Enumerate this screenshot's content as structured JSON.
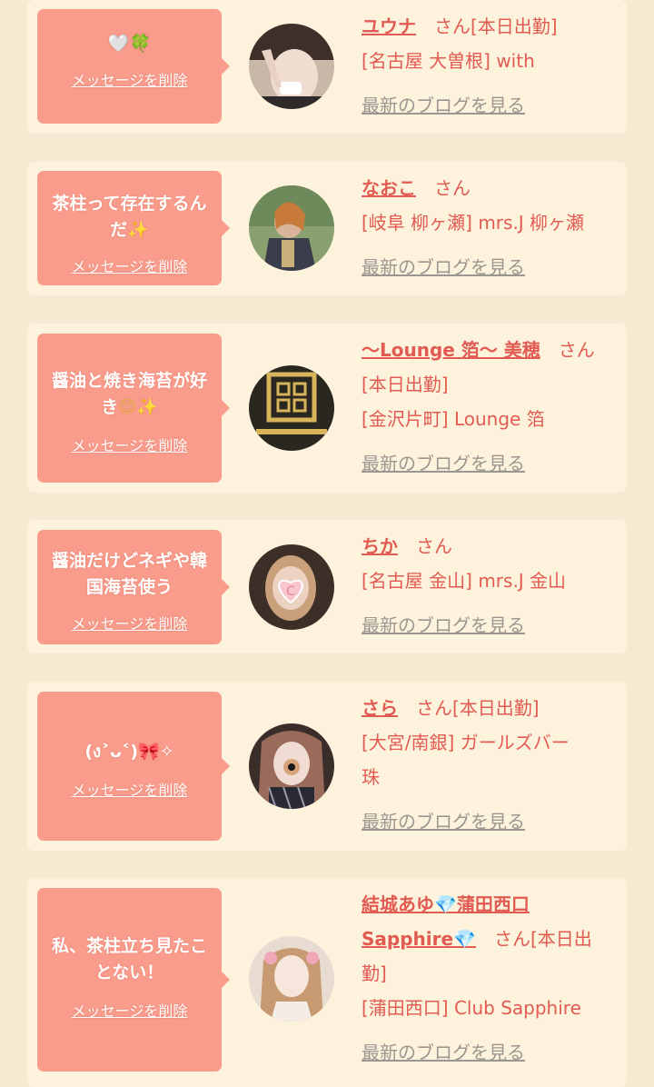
{
  "delete_label": "メッセージを削除",
  "blog_label": "最新のブログを見る",
  "cards": [
    {
      "message": "",
      "message_emoji": "🤍🍀",
      "name": "ユウナ",
      "suffix": "　さん[本日出勤]",
      "lines": [
        "[名古屋 大曽根] with"
      ]
    },
    {
      "message": "茶柱って存在するんだ",
      "message_emoji": "✨",
      "name": "なおこ",
      "suffix": "　さん",
      "lines": [
        "[岐阜 柳ヶ瀬] mrs.J 柳ヶ瀬"
      ]
    },
    {
      "message": "醤油と焼き海苔が好き",
      "message_emoji": "😊✨",
      "name": "〜Lounge 箔〜 美穂",
      "suffix": "　さん",
      "lines": [
        "[本日出勤]",
        "[金沢片町] Lounge 箔"
      ]
    },
    {
      "message": "醤油だけどネギや韓国海苔使う",
      "message_emoji": "",
      "name": "ちか",
      "suffix": "　さん",
      "lines": [
        "[名古屋 金山] mrs.J 金山"
      ]
    },
    {
      "message": "(ง˃ᴗ˂)🎀✧",
      "message_emoji": "",
      "name": "さら",
      "suffix": "　さん[本日出勤]",
      "lines": [
        "[大宮/南銀] ガールズバー",
        "珠"
      ]
    },
    {
      "message": "私、茶柱立ち見たことない！",
      "message_emoji": "",
      "name": "結城あゆ💎蒲田西口",
      "name2": "Sapphire💎",
      "suffix": "　さん[本日出",
      "lines": [
        "勤]",
        "[蒲田西口] Club Sapphire"
      ]
    }
  ]
}
